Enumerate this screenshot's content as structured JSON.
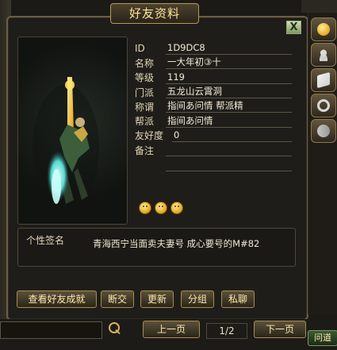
{
  "window": {
    "title": "好友资料"
  },
  "close_label": "X",
  "profile": {
    "fields": [
      {
        "label": "ID",
        "value": "1D9DC8"
      },
      {
        "label": "名称",
        "value": "一大年初③十"
      },
      {
        "label": "等级",
        "value": "119"
      },
      {
        "label": "门派",
        "value": "五龙山云霄洞"
      },
      {
        "label": "称谓",
        "value": "指间あ问情 帮派精"
      },
      {
        "label": "帮派",
        "value": "指间あ问情"
      },
      {
        "label": "友好度",
        "value": "0"
      },
      {
        "label": "备注",
        "value": ""
      }
    ],
    "rating_icons": [
      "smiley-icon",
      "smiley-icon",
      "smiley-icon"
    ]
  },
  "signature": {
    "label": "个性签名",
    "text": "青海西宁当面卖夫妻号 成心要号的M#82"
  },
  "buttons": {
    "view_friend_achievement": "查看好友成就",
    "break_off": "断交",
    "update": "更新",
    "group": "分组",
    "private_chat": "私聊"
  },
  "pager": {
    "prev": "上一页",
    "page_text": "1/2",
    "next": "下一页"
  },
  "footer_tab": "问道",
  "sidebar_icons": [
    "smiley-icon",
    "contacts-icon",
    "book-icon",
    "bell-icon",
    "feather-icon"
  ],
  "colors": {
    "accent_gold": "#d5b45b",
    "panel_border": "#6b5f43",
    "title_text": "#ffe59b"
  }
}
